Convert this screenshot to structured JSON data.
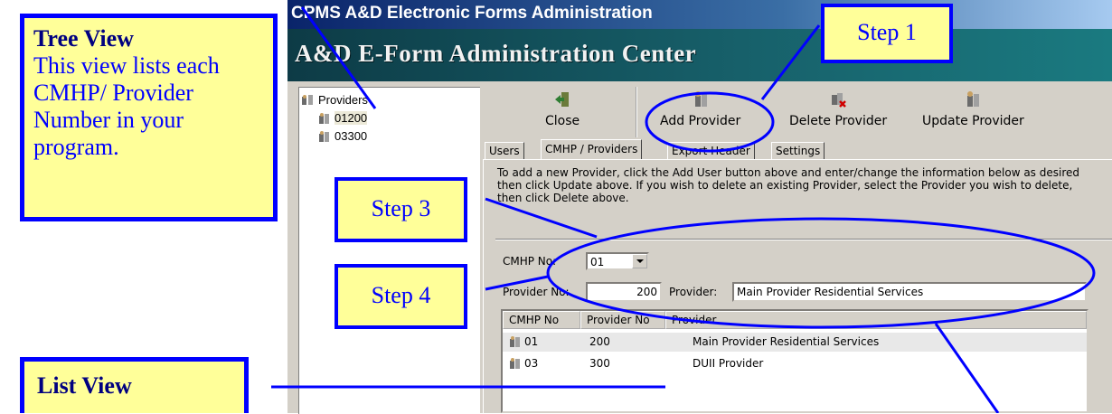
{
  "window": {
    "title": "CPMS A&D Electronic Forms Administration",
    "banner": "A&D E-Form Administration Center"
  },
  "tree": {
    "root": "Providers",
    "items": [
      "01200",
      "03300"
    ]
  },
  "toolbar": {
    "close_label": "Close",
    "add_label": "Add Provider",
    "delete_label": "Delete Provider",
    "update_label": "Update Provider"
  },
  "tabs": [
    "Users",
    "CMHP / Providers",
    "Export Header",
    "Settings"
  ],
  "description": "To add a new Provider, click the Add User button above and enter/change the information below as desired then click Update above.  If you wish to delete an existing Provider, select the Provider you wish to delete, then click Delete above.",
  "form": {
    "cmhp_label": "CMHP No:",
    "cmhp_value": "01",
    "provider_no_label": "Provider No:",
    "provider_no_value": "200",
    "provider_label": "Provider:",
    "provider_value": "Main Provider Residential Services"
  },
  "list": {
    "columns": [
      "CMHP No",
      "Provider No",
      "Provider"
    ],
    "rows": [
      {
        "cmhp": "01",
        "provider_no": "200",
        "provider": "Main Provider Residential Services"
      },
      {
        "cmhp": "03",
        "provider_no": "300",
        "provider": "DUII Provider"
      }
    ]
  },
  "annotations": {
    "tree_view_title": "Tree View",
    "tree_view_body": "This view lists each CMHP/ Provider Number in your program.",
    "step1": "Step 1",
    "step3": "Step 3",
    "step4": "Step 4",
    "list_view_title": "List View"
  },
  "colors": {
    "callout_fill": "#ffff99",
    "callout_border": "#0000ff",
    "title_gradient_start": "#0a246a",
    "banner_teal": "#17606a"
  }
}
